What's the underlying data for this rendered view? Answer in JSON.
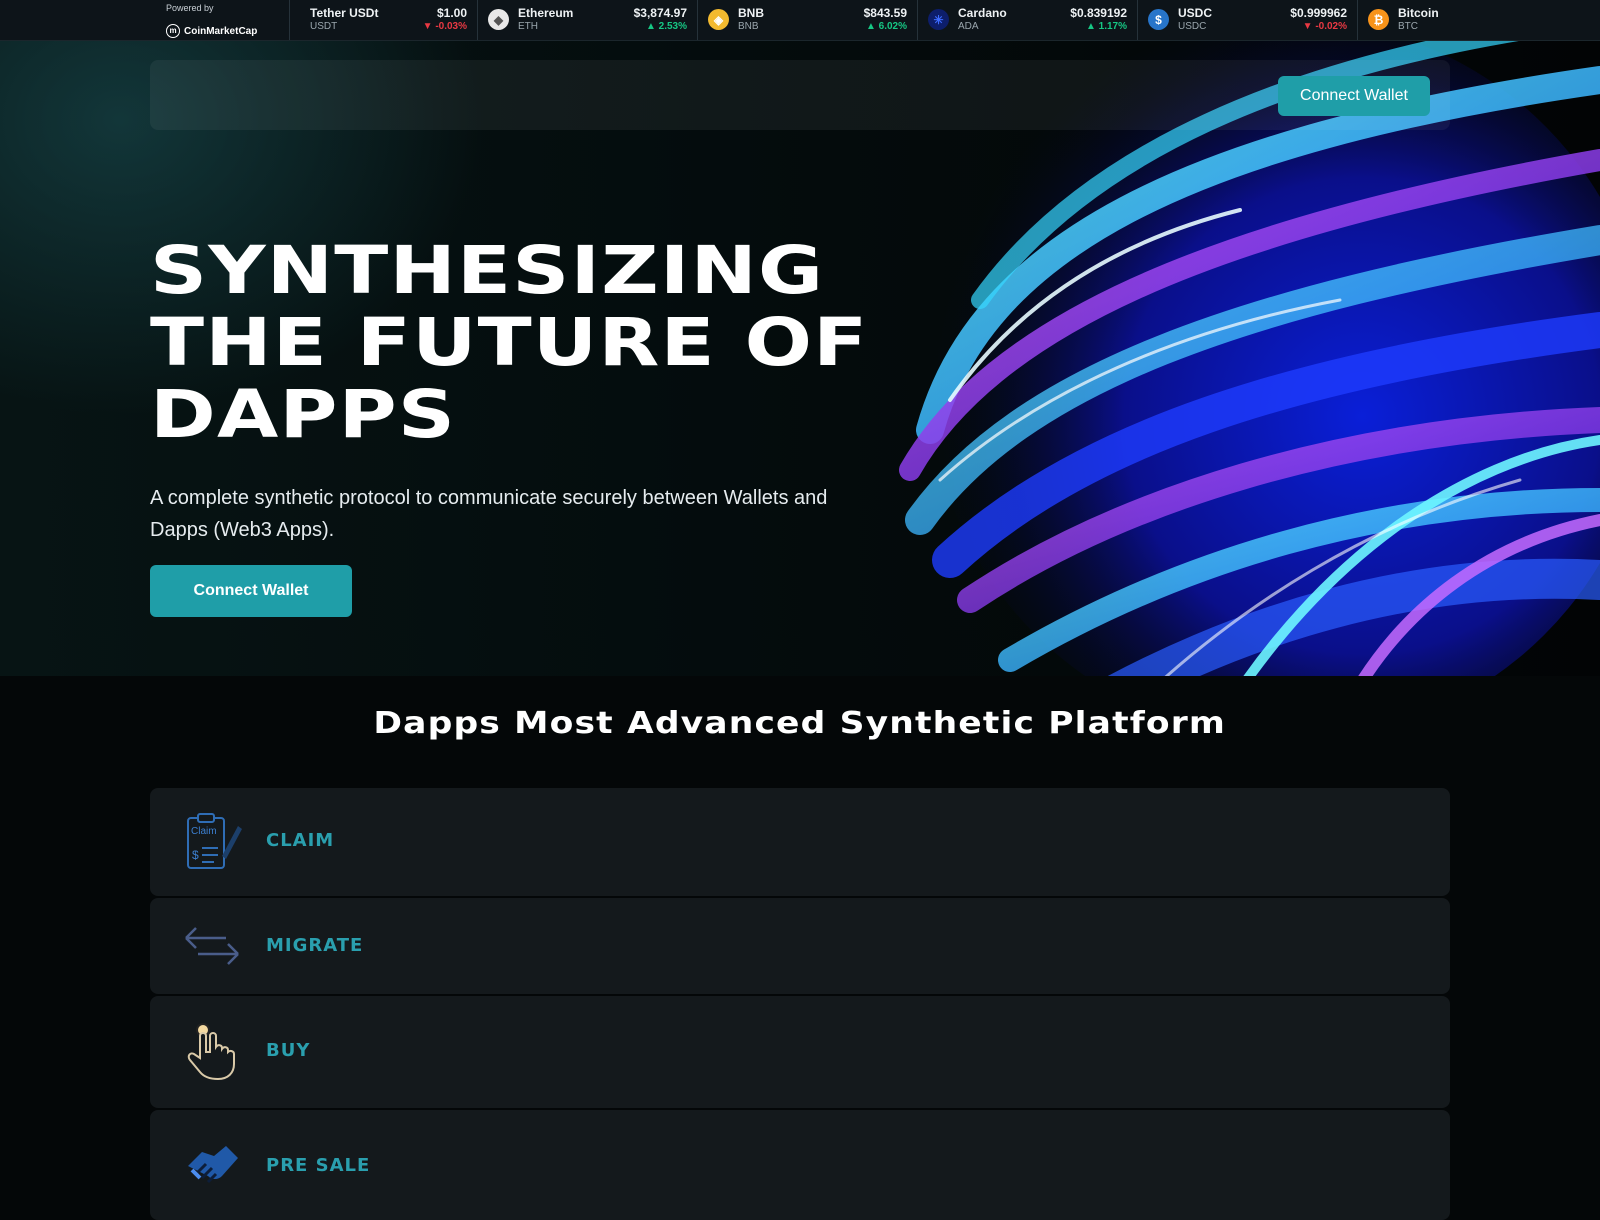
{
  "ticker": {
    "powered_by": "Powered by",
    "provider": "CoinMarketCap",
    "coins": [
      {
        "name": "Tether USDt",
        "symbol": "USDT",
        "price": "$1.00",
        "change": "-0.03%",
        "direction": "down",
        "icon": "tether-icon",
        "color": "#26a17b",
        "glyph": "₮"
      },
      {
        "name": "Ethereum",
        "symbol": "ETH",
        "price": "$3,874.97",
        "change": "2.53%",
        "direction": "up",
        "icon": "ethereum-icon",
        "color": "#e8e8e8",
        "glyph": "◆"
      },
      {
        "name": "BNB",
        "symbol": "BNB",
        "price": "$843.59",
        "change": "6.02%",
        "direction": "up",
        "icon": "bnb-icon",
        "color": "#f3ba2f",
        "glyph": "◈"
      },
      {
        "name": "Cardano",
        "symbol": "ADA",
        "price": "$0.839192",
        "change": "1.17%",
        "direction": "up",
        "icon": "cardano-icon",
        "color": "#0d1e6b",
        "glyph": "✳"
      },
      {
        "name": "USDC",
        "symbol": "USDC",
        "price": "$0.999962",
        "change": "-0.02%",
        "direction": "down",
        "icon": "usdc-icon",
        "color": "#2775ca",
        "glyph": "$"
      },
      {
        "name": "Bitcoin",
        "symbol": "BTC",
        "price": "",
        "change": "",
        "direction": "up",
        "icon": "bitcoin-icon",
        "color": "#f7931a",
        "glyph": "₿"
      }
    ]
  },
  "nav": {
    "connect_label": "Connect Wallet"
  },
  "hero": {
    "title": "SYNTHESIZING\nTHE FUTURE OF\nDAPPS",
    "subtitle": "A complete synthetic protocol to communicate securely between Wallets and Dapps (Web3 Apps).",
    "cta_label": "Connect Wallet"
  },
  "features": {
    "title": "Dapps Most Advanced Synthetic Platform",
    "items": [
      {
        "label": "CLAIM",
        "icon": "claim-clipboard-icon",
        "icon_text": "Claim"
      },
      {
        "label": "MIGRATE",
        "icon": "migrate-arrows-icon"
      },
      {
        "label": "BUY",
        "icon": "buy-hand-pointer-icon"
      },
      {
        "label": "PRE SALE",
        "icon": "presale-handshake-icon"
      }
    ]
  },
  "colors": {
    "accent": "#1f9ea8",
    "feature_label": "#2a9fae",
    "up": "#16c784",
    "down": "#ea3943"
  }
}
